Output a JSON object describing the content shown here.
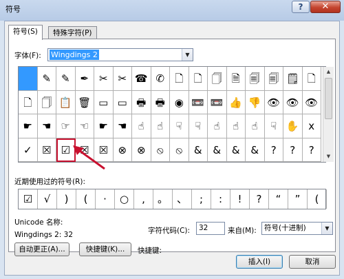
{
  "window": {
    "title": "符号",
    "help_icon": "?",
    "close_icon": "✕"
  },
  "tabs": [
    {
      "label": "符号(S)"
    },
    {
      "label": "特殊字符(P)"
    }
  ],
  "font": {
    "label": "字体(F):",
    "value": "Wingdings 2"
  },
  "symbols": [
    [
      "",
      "✎",
      "✎",
      "✒",
      "✂",
      "✂",
      "☎",
      "✆",
      "🗋",
      "🗋",
      "🗍",
      "🗎",
      "🗐",
      "🗐",
      "🗒",
      "🗋"
    ],
    [
      "🗋",
      "🗍",
      "📋",
      "🗑",
      "▭",
      "▭",
      "🖶",
      "🖶",
      "◉",
      "📼",
      "📼",
      "👍",
      "👎",
      "👁",
      "👁",
      "👁"
    ],
    [
      "☛",
      "☚",
      "☞",
      "☜",
      "☛",
      "☚",
      "☝",
      "☝",
      "☟",
      "☟",
      "☝",
      "☝",
      "☝",
      "☟",
      "✋",
      "x"
    ],
    [
      "✓",
      "☒",
      "☑",
      "☒",
      "☒",
      "⊗",
      "⊗",
      "⦸",
      "⦸",
      "&",
      "&",
      "&",
      "&",
      "?",
      "?",
      "?"
    ]
  ],
  "recent": {
    "label": "近期使用过的符号(R):",
    "items": [
      "☑",
      "√",
      ")",
      "(",
      "·",
      "○",
      ",",
      "。",
      "、",
      ";",
      ":",
      "!",
      "?",
      "“",
      "”",
      "("
    ]
  },
  "unicode": {
    "label": "Unicode 名称:",
    "value": "Wingdings 2: 32"
  },
  "char_code": {
    "label": "字符代码(C):",
    "value": "32"
  },
  "from": {
    "label": "来自(M):",
    "value": "符号(十进制)"
  },
  "buttons": {
    "autocorrect": "自动更正(A)...",
    "shortcut_key": "快捷键(K)...",
    "shortcut_label": "快捷键:",
    "insert": "插入(I)",
    "cancel": "取消"
  },
  "accent_colors": {
    "selection": "#3399ff",
    "highlight": "#c8102e"
  }
}
